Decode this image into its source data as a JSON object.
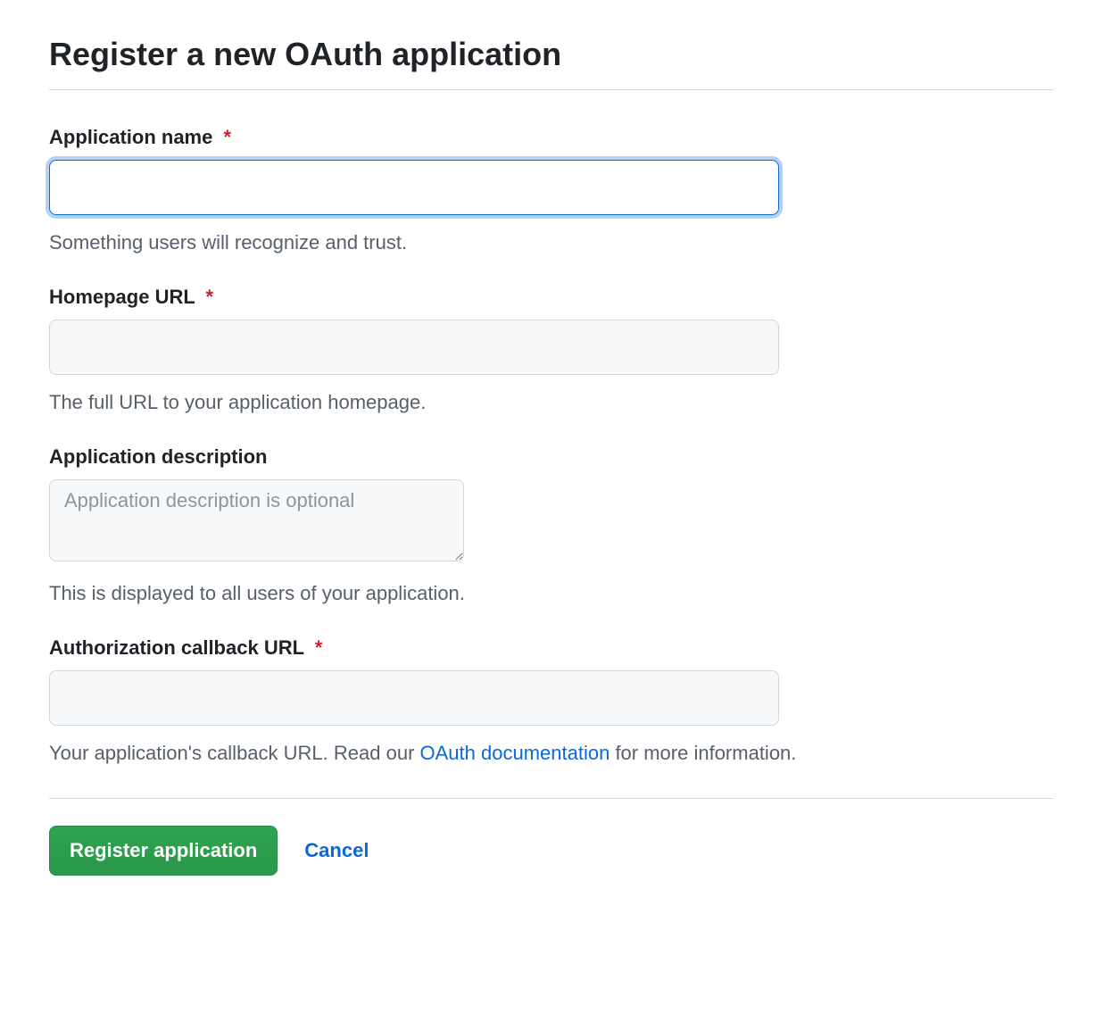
{
  "page": {
    "title": "Register a new OAuth application"
  },
  "fields": {
    "app_name": {
      "label": "Application name",
      "required_marker": "*",
      "value": "",
      "help": "Something users will recognize and trust."
    },
    "homepage_url": {
      "label": "Homepage URL",
      "required_marker": "*",
      "value": "",
      "help": "The full URL to your application homepage."
    },
    "app_description": {
      "label": "Application description",
      "placeholder": "Application description is optional",
      "value": "",
      "help": "This is displayed to all users of your application."
    },
    "callback_url": {
      "label": "Authorization callback URL",
      "required_marker": "*",
      "value": "",
      "help_prefix": "Your application's callback URL. Read our ",
      "help_link_text": "OAuth documentation",
      "help_suffix": " for more information."
    }
  },
  "actions": {
    "submit_label": "Register application",
    "cancel_label": "Cancel"
  }
}
